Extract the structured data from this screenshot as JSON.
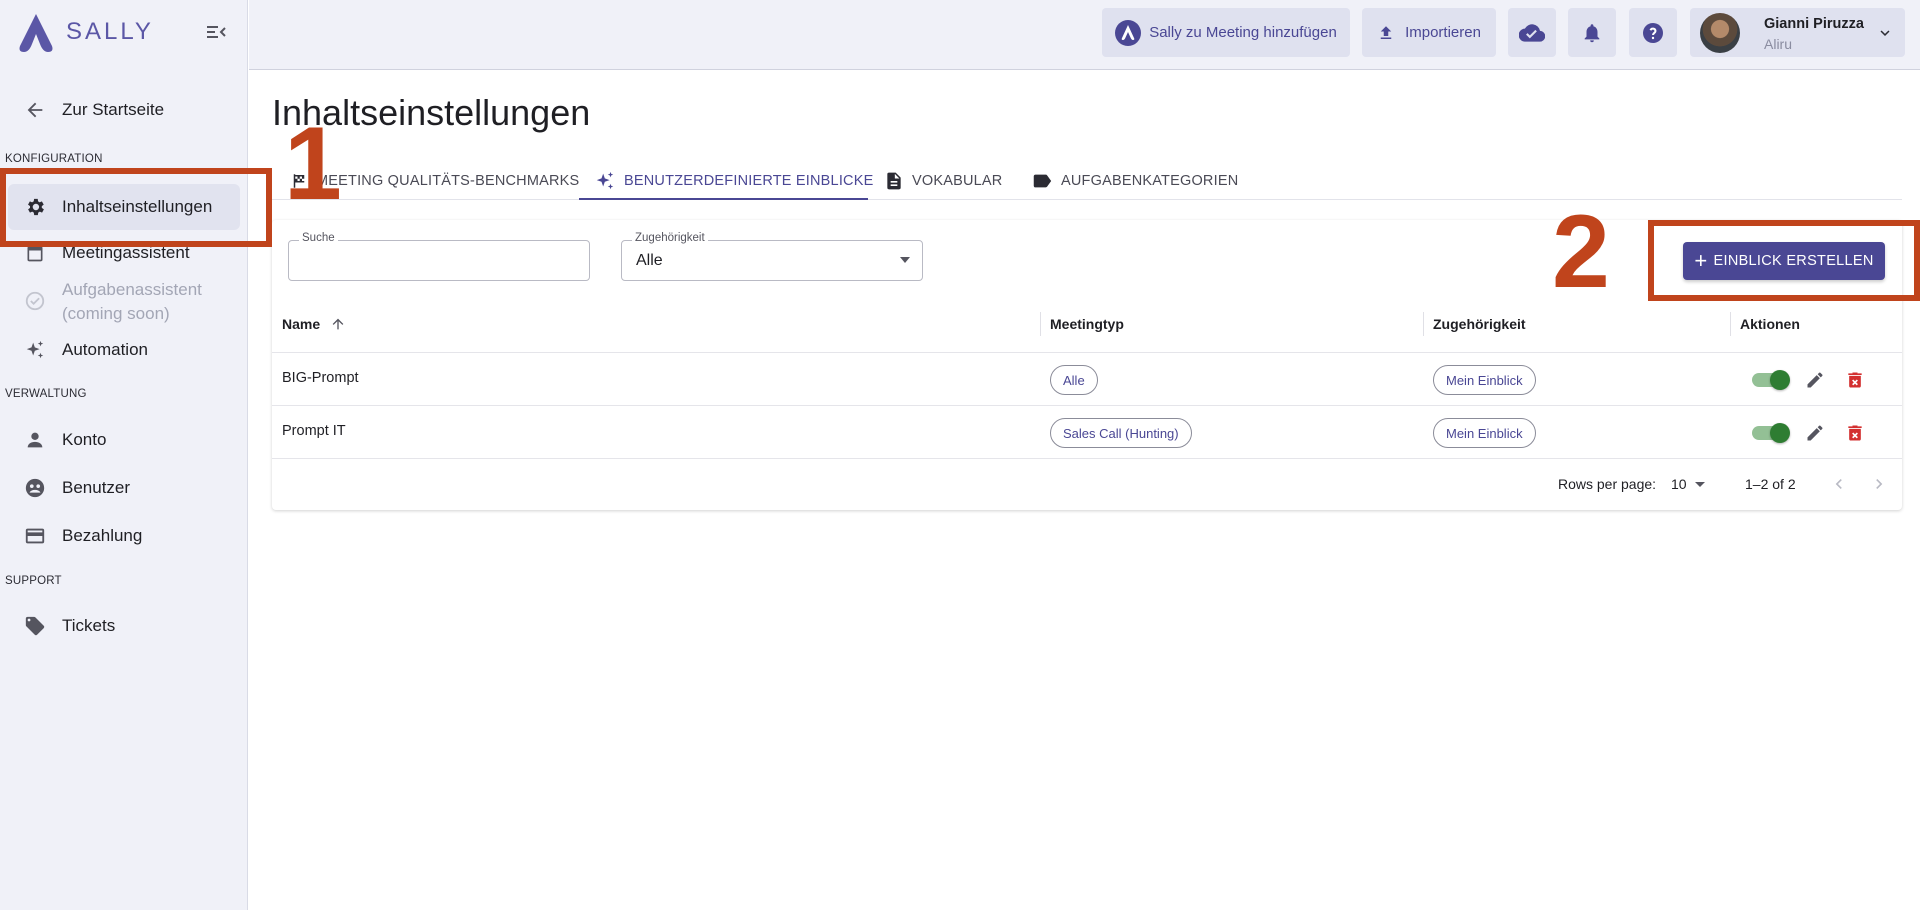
{
  "app": {
    "logo_text": "SALLY",
    "brand_color": "#4a4794"
  },
  "sidebar": {
    "back_label": "Zur Startseite",
    "sections": {
      "config": "KONFIGURATION",
      "admin": "VERWALTUNG",
      "support": "SUPPORT"
    },
    "items": [
      {
        "label": "Inhaltseinstellungen",
        "icon": "gear-icon",
        "active": true
      },
      {
        "label": "Meetingassistent",
        "icon": "calendar-icon"
      },
      {
        "label": "Aufgabenassistent",
        "sublabel": "(coming soon)",
        "icon": "check-circle-icon",
        "disabled": true
      },
      {
        "label": "Automation",
        "icon": "sparkle-icon"
      },
      {
        "label": "Konto",
        "icon": "person-icon"
      },
      {
        "label": "Benutzer",
        "icon": "group-icon"
      },
      {
        "label": "Bezahlung",
        "icon": "credit-card-icon"
      },
      {
        "label": "Tickets",
        "icon": "tag-icon"
      }
    ]
  },
  "topbar": {
    "add_sally_label": "Sally zu Meeting hinzufügen",
    "import_label": "Importieren",
    "user": {
      "name": "Gianni Piruzza",
      "org": "Aliru"
    }
  },
  "main": {
    "title": "Inhaltseinstellungen",
    "tabs": [
      {
        "label": "MEETING QUALITÄTS-BENCHMARKS",
        "icon": "checkered-flag-icon"
      },
      {
        "label": "BENUTZERDEFINIERTE EINBLICKE",
        "icon": "sparkle-icon",
        "active": true
      },
      {
        "label": "VOKABULAR",
        "icon": "document-icon"
      },
      {
        "label": "AUFGABENKATEGORIEN",
        "icon": "label-icon"
      }
    ],
    "filters": {
      "search_label": "Suche",
      "search_value": "",
      "affiliation_label": "Zugehörigkeit",
      "affiliation_value": "Alle"
    },
    "create_button_label": "EINBLICK ERSTELLEN",
    "table": {
      "columns": [
        "Name",
        "Meetingtyp",
        "Zugehörigkeit",
        "Aktionen"
      ],
      "rows": [
        {
          "name": "BIG-Prompt",
          "meeting_type": "Alle",
          "affiliation": "Mein Einblick",
          "enabled": true
        },
        {
          "name": "Prompt IT",
          "meeting_type": "Sales Call (Hunting)",
          "affiliation": "Mein Einblick",
          "enabled": true
        }
      ]
    },
    "pagination": {
      "rows_per_page_label": "Rows per page:",
      "rows_per_page": "10",
      "range": "1–2 of 2"
    }
  },
  "annotations": {
    "first": "1",
    "second": "2",
    "color": "#c0441c"
  }
}
